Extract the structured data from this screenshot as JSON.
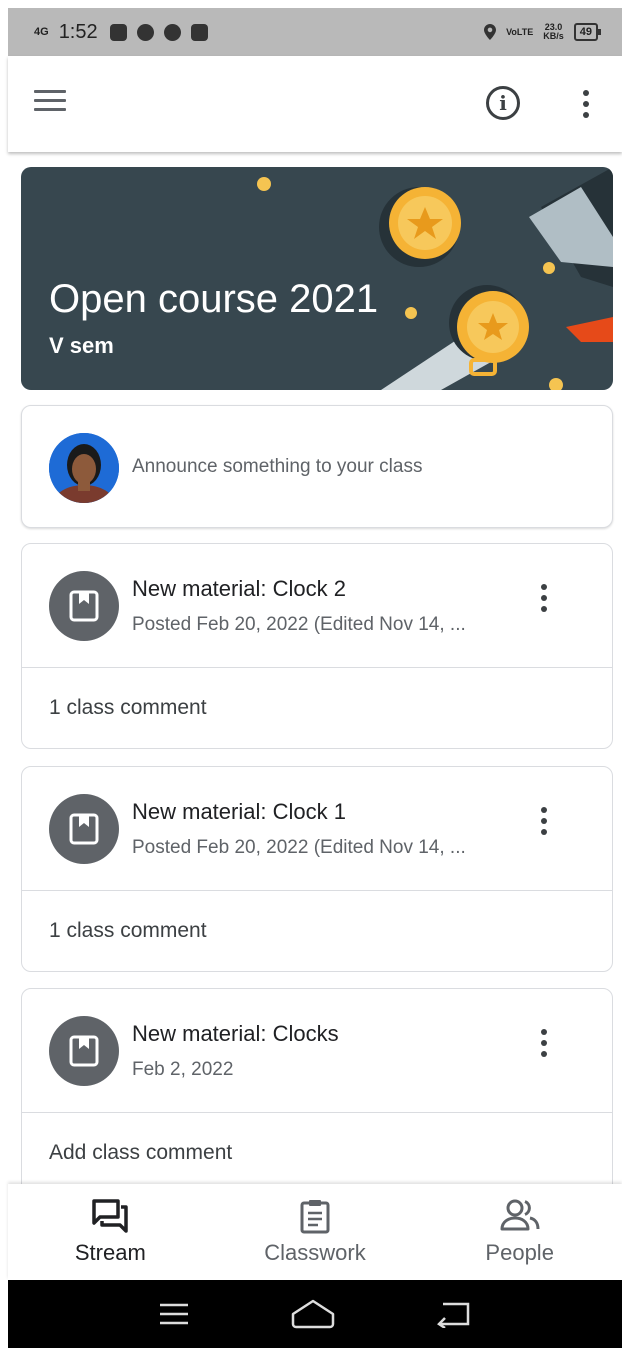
{
  "status_bar": {
    "network": "4G",
    "time": "1:52",
    "volte": "VoLTE",
    "speed_value": "23.0",
    "speed_unit": "KB/s",
    "battery": "49"
  },
  "app_bar": {
    "menu_icon": "menu-icon",
    "info_icon": "info-icon",
    "more_icon": "more-vert-icon"
  },
  "banner": {
    "title": "Open course 2021",
    "subtitle": "V sem",
    "background_color": "#37474f"
  },
  "announce": {
    "placeholder": "Announce something to your class"
  },
  "posts": [
    {
      "title": "New material: Clock 2",
      "meta": "Posted Feb 20, 2022 (Edited Nov 14, ...",
      "comment": "1 class comment"
    },
    {
      "title": "New material: Clock 1",
      "meta": "Posted Feb 20, 2022 (Edited Nov 14, ...",
      "comment": "1 class comment"
    },
    {
      "title": "New material: Clocks",
      "meta": "Feb 2, 2022",
      "comment": "Add class comment"
    }
  ],
  "bottom_nav": {
    "items": [
      {
        "label": "Stream",
        "icon": "stream-icon",
        "active": true
      },
      {
        "label": "Classwork",
        "icon": "classwork-icon",
        "active": false
      },
      {
        "label": "People",
        "icon": "people-icon",
        "active": false
      }
    ]
  },
  "colors": {
    "text_primary": "#202124",
    "text_secondary": "#5f6368",
    "divider": "#dadce0",
    "material_icon_bg": "#5f6368"
  }
}
